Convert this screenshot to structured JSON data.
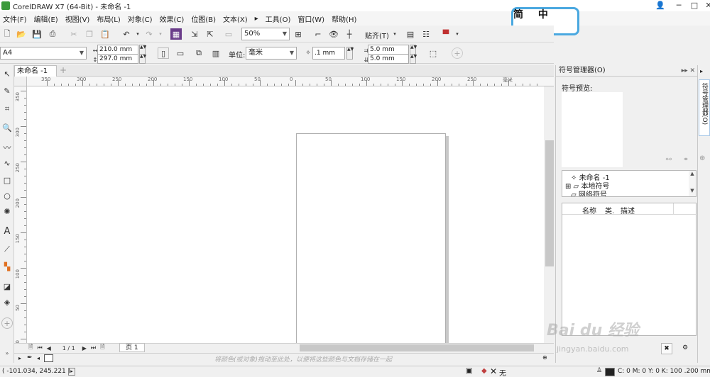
{
  "window": {
    "title": "CorelDRAW X7 (64-Bit) - 未命名 -1",
    "controls": [
      "─",
      "□",
      "✕"
    ]
  },
  "menu": [
    "文件(F)",
    "编辑(E)",
    "视图(V)",
    "布局(L)",
    "对象(C)",
    "效果(C)",
    "位图(B)",
    "文本(X)",
    "▸",
    "工具(O)",
    "窗口(W)",
    "帮助(H)"
  ],
  "ime": {
    "label": "简 中 ·。"
  },
  "toolbar": {
    "zoom": "50%",
    "snap_label": "贴齐(T)"
  },
  "property_bar": {
    "paper": "A4",
    "width": "210.0 mm",
    "height": "297.0 mm",
    "unit_label": "单位:",
    "unit": "毫米",
    "nudge": ".1 mm",
    "dup_x": "5.0 mm",
    "dup_y": "5.0 mm"
  },
  "document": {
    "tab": "未命名 -1",
    "new_tab": "+"
  },
  "ruler": {
    "h_labels": [
      "350",
      "300",
      "250",
      "200",
      "150",
      "100",
      "50",
      "0",
      "50",
      "100",
      "150",
      "200",
      "250",
      "毫米"
    ],
    "v_labels": [
      "350",
      "300",
      "250",
      "200",
      "150",
      "100",
      "50",
      "0"
    ]
  },
  "pages": {
    "counter": "1 / 1",
    "tab": "页 1"
  },
  "palette": {
    "hint": "将颜色(或对象)拖动至此处，以便将这些颜色与文档存储在一起"
  },
  "status": {
    "coords": "( -101.034, 245.221 )",
    "fill": "无",
    "outline": "C: 0 M: 0 Y: 0 K: 100  .200 mm"
  },
  "docker": {
    "title": "符号管理器(O)",
    "preview_label": "符号预览:",
    "tree": [
      "未命名 -1",
      "本地符号",
      "网络符号"
    ],
    "columns": [
      "名称",
      "类.",
      "描述"
    ],
    "side_tab": "符号管理器(O)"
  },
  "watermark": {
    "logo": "Bai du 经验",
    "url": "jingyan.baidu.com"
  },
  "colors": {
    "accent": "#4aa8e0",
    "page_bg": "#ffffff",
    "chrome": "#f0f0f0"
  }
}
